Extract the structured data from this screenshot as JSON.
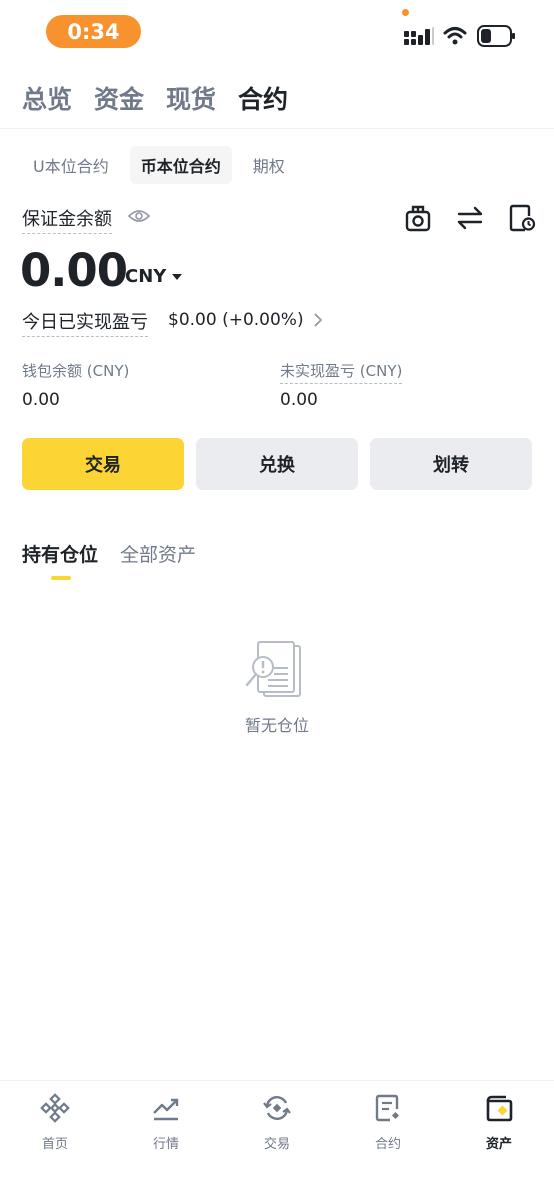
{
  "status_bar": {
    "time": "0:34"
  },
  "top_tabs": [
    {
      "label": "总览",
      "active": false
    },
    {
      "label": "资金",
      "active": false
    },
    {
      "label": "现货",
      "active": false
    },
    {
      "label": "合约",
      "active": true
    }
  ],
  "sub_tabs": [
    {
      "label": "U本位合约",
      "active": false
    },
    {
      "label": "币本位合约",
      "active": true
    },
    {
      "label": "期权",
      "active": false
    }
  ],
  "margin": {
    "label": "保证金余额",
    "value": "0.00",
    "currency": "CNY"
  },
  "today_pnl": {
    "label": "今日已实现盈亏",
    "value": "$0.00 (+0.00%)"
  },
  "wallet": {
    "label": "钱包余额 (CNY)",
    "value": "0.00"
  },
  "unrealized": {
    "label": "未实现盈亏 (CNY)",
    "value": "0.00"
  },
  "actions": {
    "trade": "交易",
    "convert": "兑换",
    "transfer": "划转"
  },
  "position_tabs": [
    {
      "label": "持有仓位",
      "active": true
    },
    {
      "label": "全部资产",
      "active": false
    }
  ],
  "empty_state": {
    "text": "暂无仓位"
  },
  "bottom_nav": [
    {
      "label": "首页",
      "icon": "binance-logo-icon",
      "active": false
    },
    {
      "label": "行情",
      "icon": "trend-chart-icon",
      "active": false
    },
    {
      "label": "交易",
      "icon": "trade-swap-icon",
      "active": false
    },
    {
      "label": "合约",
      "icon": "contract-doc-icon",
      "active": false
    },
    {
      "label": "资产",
      "icon": "wallet-icon",
      "active": true
    }
  ],
  "colors": {
    "accent": "#fcd535",
    "status_pill": "#f7922f",
    "text_primary": "#1e2329",
    "text_secondary": "#707a8a"
  }
}
